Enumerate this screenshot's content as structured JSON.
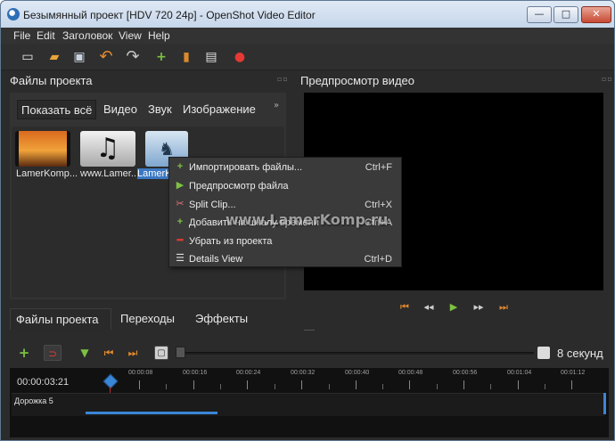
{
  "window": {
    "title": "Безымянный проект [HDV 720 24p] - OpenShot Video Editor",
    "controls": {
      "minimize": "—",
      "maximize": "□",
      "close": "✕"
    }
  },
  "menubar": [
    "File",
    "Edit",
    "Заголовок",
    "View",
    "Help"
  ],
  "toolbar": {
    "icons": [
      "new-project-icon",
      "open-project-icon",
      "save-project-icon",
      "undo-icon",
      "redo-icon",
      "add-file-icon",
      "film-icon",
      "export-icon",
      "record-icon"
    ]
  },
  "files_panel": {
    "title": "Файлы проекта",
    "filters": [
      "Показать всё",
      "Видео",
      "Звук",
      "Изображение"
    ],
    "more": "»",
    "files": [
      {
        "label": "LamerKomp..."
      },
      {
        "label": "www.Lamer..."
      },
      {
        "label": "LamerK..."
      }
    ]
  },
  "context_menu": {
    "items": [
      {
        "label": "Импортировать файлы...",
        "shortcut": "Ctrl+F",
        "icon": "plus-icon"
      },
      {
        "label": "Предпросмотр файла",
        "shortcut": "",
        "icon": "play-icon"
      },
      {
        "label": "Split Clip...",
        "shortcut": "Ctrl+X",
        "icon": "scissors-icon"
      },
      {
        "label": "Добавить на шкалу времени",
        "shortcut": "Ctrl+A",
        "icon": "plus-icon"
      },
      {
        "label": "Убрать из проекта",
        "shortcut": "",
        "icon": "minus-icon"
      },
      {
        "label": "Details View",
        "shortcut": "Ctrl+D",
        "icon": "details-view-icon"
      }
    ]
  },
  "watermark": "www.LamerKomp.ru",
  "preview_panel": {
    "title": "Предпросмотр видео",
    "controls": [
      "jump-start-icon",
      "rewind-icon",
      "play-icon",
      "fast-forward-icon",
      "jump-end-icon"
    ]
  },
  "bottom_tabs": [
    "Файлы проекта",
    "Переходы",
    "Эффекты"
  ],
  "timeline": {
    "zoom_label": "8 секунд",
    "current_time": "00:00:03:21",
    "ruler": [
      "00:00:08",
      "00:00:16",
      "00:00:24",
      "00:00:32",
      "00:00:40",
      "00:00:48",
      "00:00:56",
      "00:01:04",
      "00:01:12"
    ],
    "track_name": "Дорожка 5"
  }
}
